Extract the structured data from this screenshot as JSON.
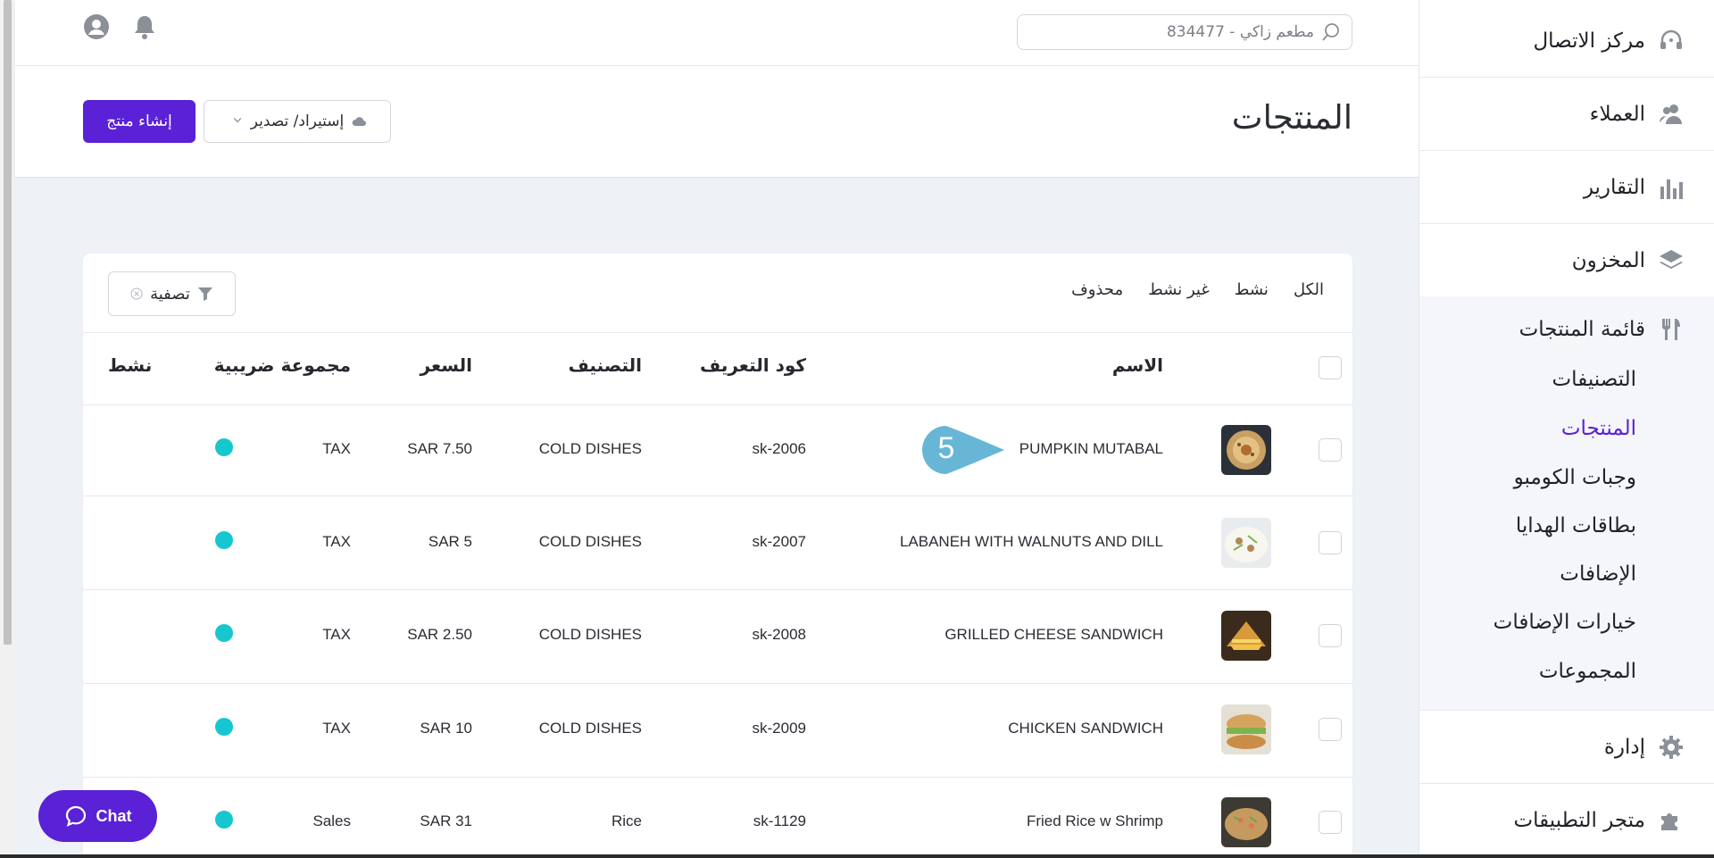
{
  "search": {
    "value": "مطعم زاكي - 834477"
  },
  "header": {
    "title": "المنتجات",
    "create_label": "إنشاء منتج",
    "import_export_label": "إستيراد/ تصدير"
  },
  "filters": {
    "tabs": [
      "الكل",
      "نشط",
      "غير نشط",
      "محذوف"
    ],
    "filter_label": "تصفية"
  },
  "table": {
    "columns": {
      "name": "الاسم",
      "code": "كود التعريف",
      "category": "التصنيف",
      "price": "السعر",
      "tax_group": "مجموعة ضريبية",
      "active": "نشط"
    },
    "rows": [
      {
        "name": "PUMPKIN MUTABAL",
        "code": "sk-2006",
        "category": "COLD DISHES",
        "price": "SAR 7.50",
        "tax": "TAX",
        "active": true
      },
      {
        "name": "LABANEH WITH WALNUTS AND DILL",
        "code": "sk-2007",
        "category": "COLD DISHES",
        "price": "SAR 5",
        "tax": "TAX",
        "active": true
      },
      {
        "name": "GRILLED CHEESE SANDWICH",
        "code": "sk-2008",
        "category": "COLD DISHES",
        "price": "SAR 2.50",
        "tax": "TAX",
        "active": true
      },
      {
        "name": "CHICKEN SANDWICH",
        "code": "sk-2009",
        "category": "COLD DISHES",
        "price": "SAR 10",
        "tax": "TAX",
        "active": true
      },
      {
        "name": "Fried Rice w Shrimp",
        "code": "sk-1129",
        "category": "Rice",
        "price": "SAR 31",
        "tax": "Sales",
        "active": true
      }
    ]
  },
  "tooltip": {
    "number": "5"
  },
  "chat": {
    "label": "Chat"
  },
  "sidebar": {
    "call_center": "مركز الاتصال",
    "customers": "العملاء",
    "reports": "التقارير",
    "inventory": "المخزون",
    "products_menu": "قائمة المنتجات",
    "sub_items": [
      "التصنيفات",
      "المنتجات",
      "وجبات الكومبو",
      "بطاقات الهدايا",
      "الإضافات",
      "خيارات الإضافات",
      "المجموعات"
    ],
    "admin": "إدارة",
    "app_store": "متجر التطبيقات"
  },
  "colors": {
    "accent": "#5a21d6",
    "active_dot": "#17c7cf",
    "tooltip": "#67b6d6"
  }
}
